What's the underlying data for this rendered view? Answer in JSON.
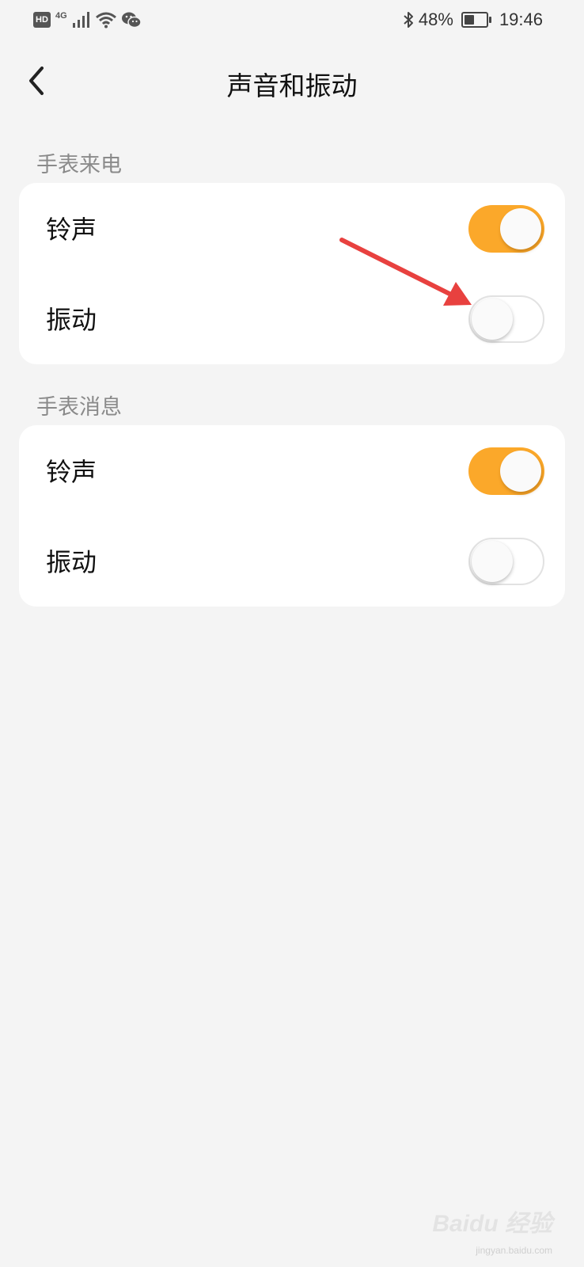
{
  "status_bar": {
    "hd": "HD",
    "network": "4G",
    "battery_text": "48%",
    "battery_level": 0.48,
    "time": "19:46"
  },
  "header": {
    "title": "声音和振动"
  },
  "sections": [
    {
      "label": "手表来电",
      "rows": [
        {
          "label": "铃声",
          "on": true
        },
        {
          "label": "振动",
          "on": false
        }
      ]
    },
    {
      "label": "手表消息",
      "rows": [
        {
          "label": "铃声",
          "on": true
        },
        {
          "label": "振动",
          "on": false
        }
      ]
    }
  ],
  "colors": {
    "accent": "#fba82a",
    "background": "#f4f4f4",
    "card": "#ffffff",
    "annotation_arrow": "#e8413f"
  },
  "watermark": {
    "brand": "Baidu 经验",
    "url": "jingyan.baidu.com"
  }
}
